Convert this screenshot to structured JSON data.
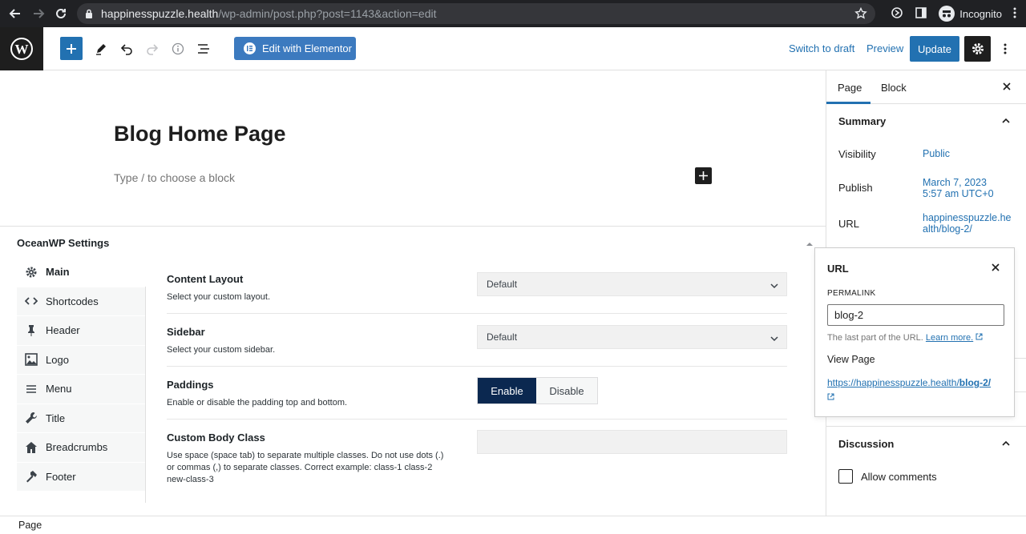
{
  "browser": {
    "url_host": "happinesspuzzle.health",
    "url_path": "/wp-admin/post.php?post=1143&action=edit",
    "profile": "Incognito"
  },
  "header": {
    "edit_elementor": "Edit with Elementor",
    "switch_draft": "Switch to draft",
    "preview": "Preview",
    "update": "Update"
  },
  "editor": {
    "title": "Blog Home Page",
    "placeholder": "Type / to choose a block"
  },
  "oceanwp": {
    "title": "OceanWP Settings",
    "nav": [
      {
        "label": "Main",
        "icon": "gear-icon"
      },
      {
        "label": "Shortcodes",
        "icon": "code-icon"
      },
      {
        "label": "Header",
        "icon": "pin-icon"
      },
      {
        "label": "Logo",
        "icon": "image-icon"
      },
      {
        "label": "Menu",
        "icon": "menu-icon"
      },
      {
        "label": "Title",
        "icon": "wrench-icon"
      },
      {
        "label": "Breadcrumbs",
        "icon": "home-icon"
      },
      {
        "label": "Footer",
        "icon": "hammer-icon"
      }
    ],
    "rows": [
      {
        "label": "Content Layout",
        "desc": "Select your custom layout.",
        "value": "Default"
      },
      {
        "label": "Sidebar",
        "desc": "Select your custom sidebar.",
        "value": "Default"
      },
      {
        "label": "Paddings",
        "desc": "Enable or disable the padding top and bottom.",
        "enable": "Enable",
        "disable": "Disable"
      },
      {
        "label": "Custom Body Class",
        "desc": "Use space (space tab) to separate multiple classes. Do not use dots (.) or commas (,) to separate classes. Correct example: class-1 class-2 new-class-3",
        "value": ""
      }
    ]
  },
  "sidebar": {
    "tabs": [
      "Page",
      "Block"
    ],
    "summary": "Summary",
    "visibility_label": "Visibility",
    "visibility_value": "Public",
    "publish_label": "Publish",
    "publish_value_1": "March 7, 2023",
    "publish_value_2": "5:57 am UTC+0",
    "url_label": "URL",
    "url_value": "happinesspuzzle.health/blog-2/",
    "discussion": "Discussion",
    "allow_comments": "Allow comments"
  },
  "popover": {
    "title": "URL",
    "permalink_label": "PERMALINK",
    "slug": "blog-2",
    "help": "The last part of the URL.",
    "learn_more": "Learn more.",
    "view_page": "View Page",
    "link_prefix": "https://happinesspuzzle.health/",
    "link_slug": "blog-2/"
  },
  "footer": {
    "breadcrumb": "Page"
  }
}
